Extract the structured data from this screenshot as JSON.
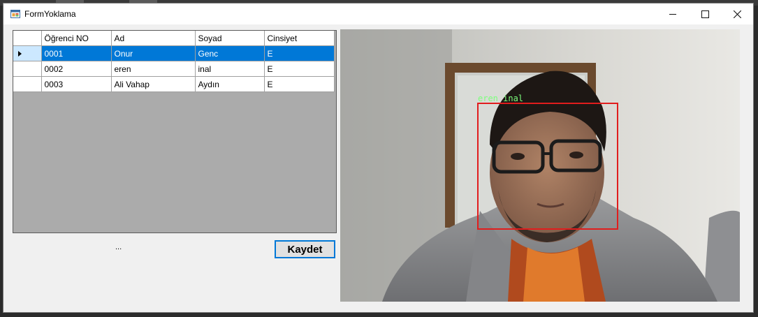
{
  "window": {
    "title": "FormYoklama",
    "minimize_icon": "minimize-icon",
    "maximize_icon": "maximize-icon",
    "close_icon": "close-icon"
  },
  "grid": {
    "columns": [
      "Öğrenci NO",
      "Ad",
      "Soyad",
      "Cinsiyet"
    ],
    "rows": [
      {
        "no": "0001",
        "ad": "Onur",
        "soyad": "Genc",
        "cinsiyet": "E"
      },
      {
        "no": "0002",
        "ad": "eren",
        "soyad": "inal",
        "cinsiyet": "E"
      },
      {
        "no": "0003",
        "ad": "Ali Vahap",
        "soyad": "Aydın",
        "cinsiyet": "E"
      }
    ],
    "selected_row": 0
  },
  "status_label": "...",
  "save_button": "Kaydet",
  "camera": {
    "detected_name": "eren inal",
    "box_color": "#e11d1d",
    "label_color": "#7dff7d"
  },
  "colors": {
    "selection": "#0078d7",
    "button_border": "#0078d7"
  }
}
